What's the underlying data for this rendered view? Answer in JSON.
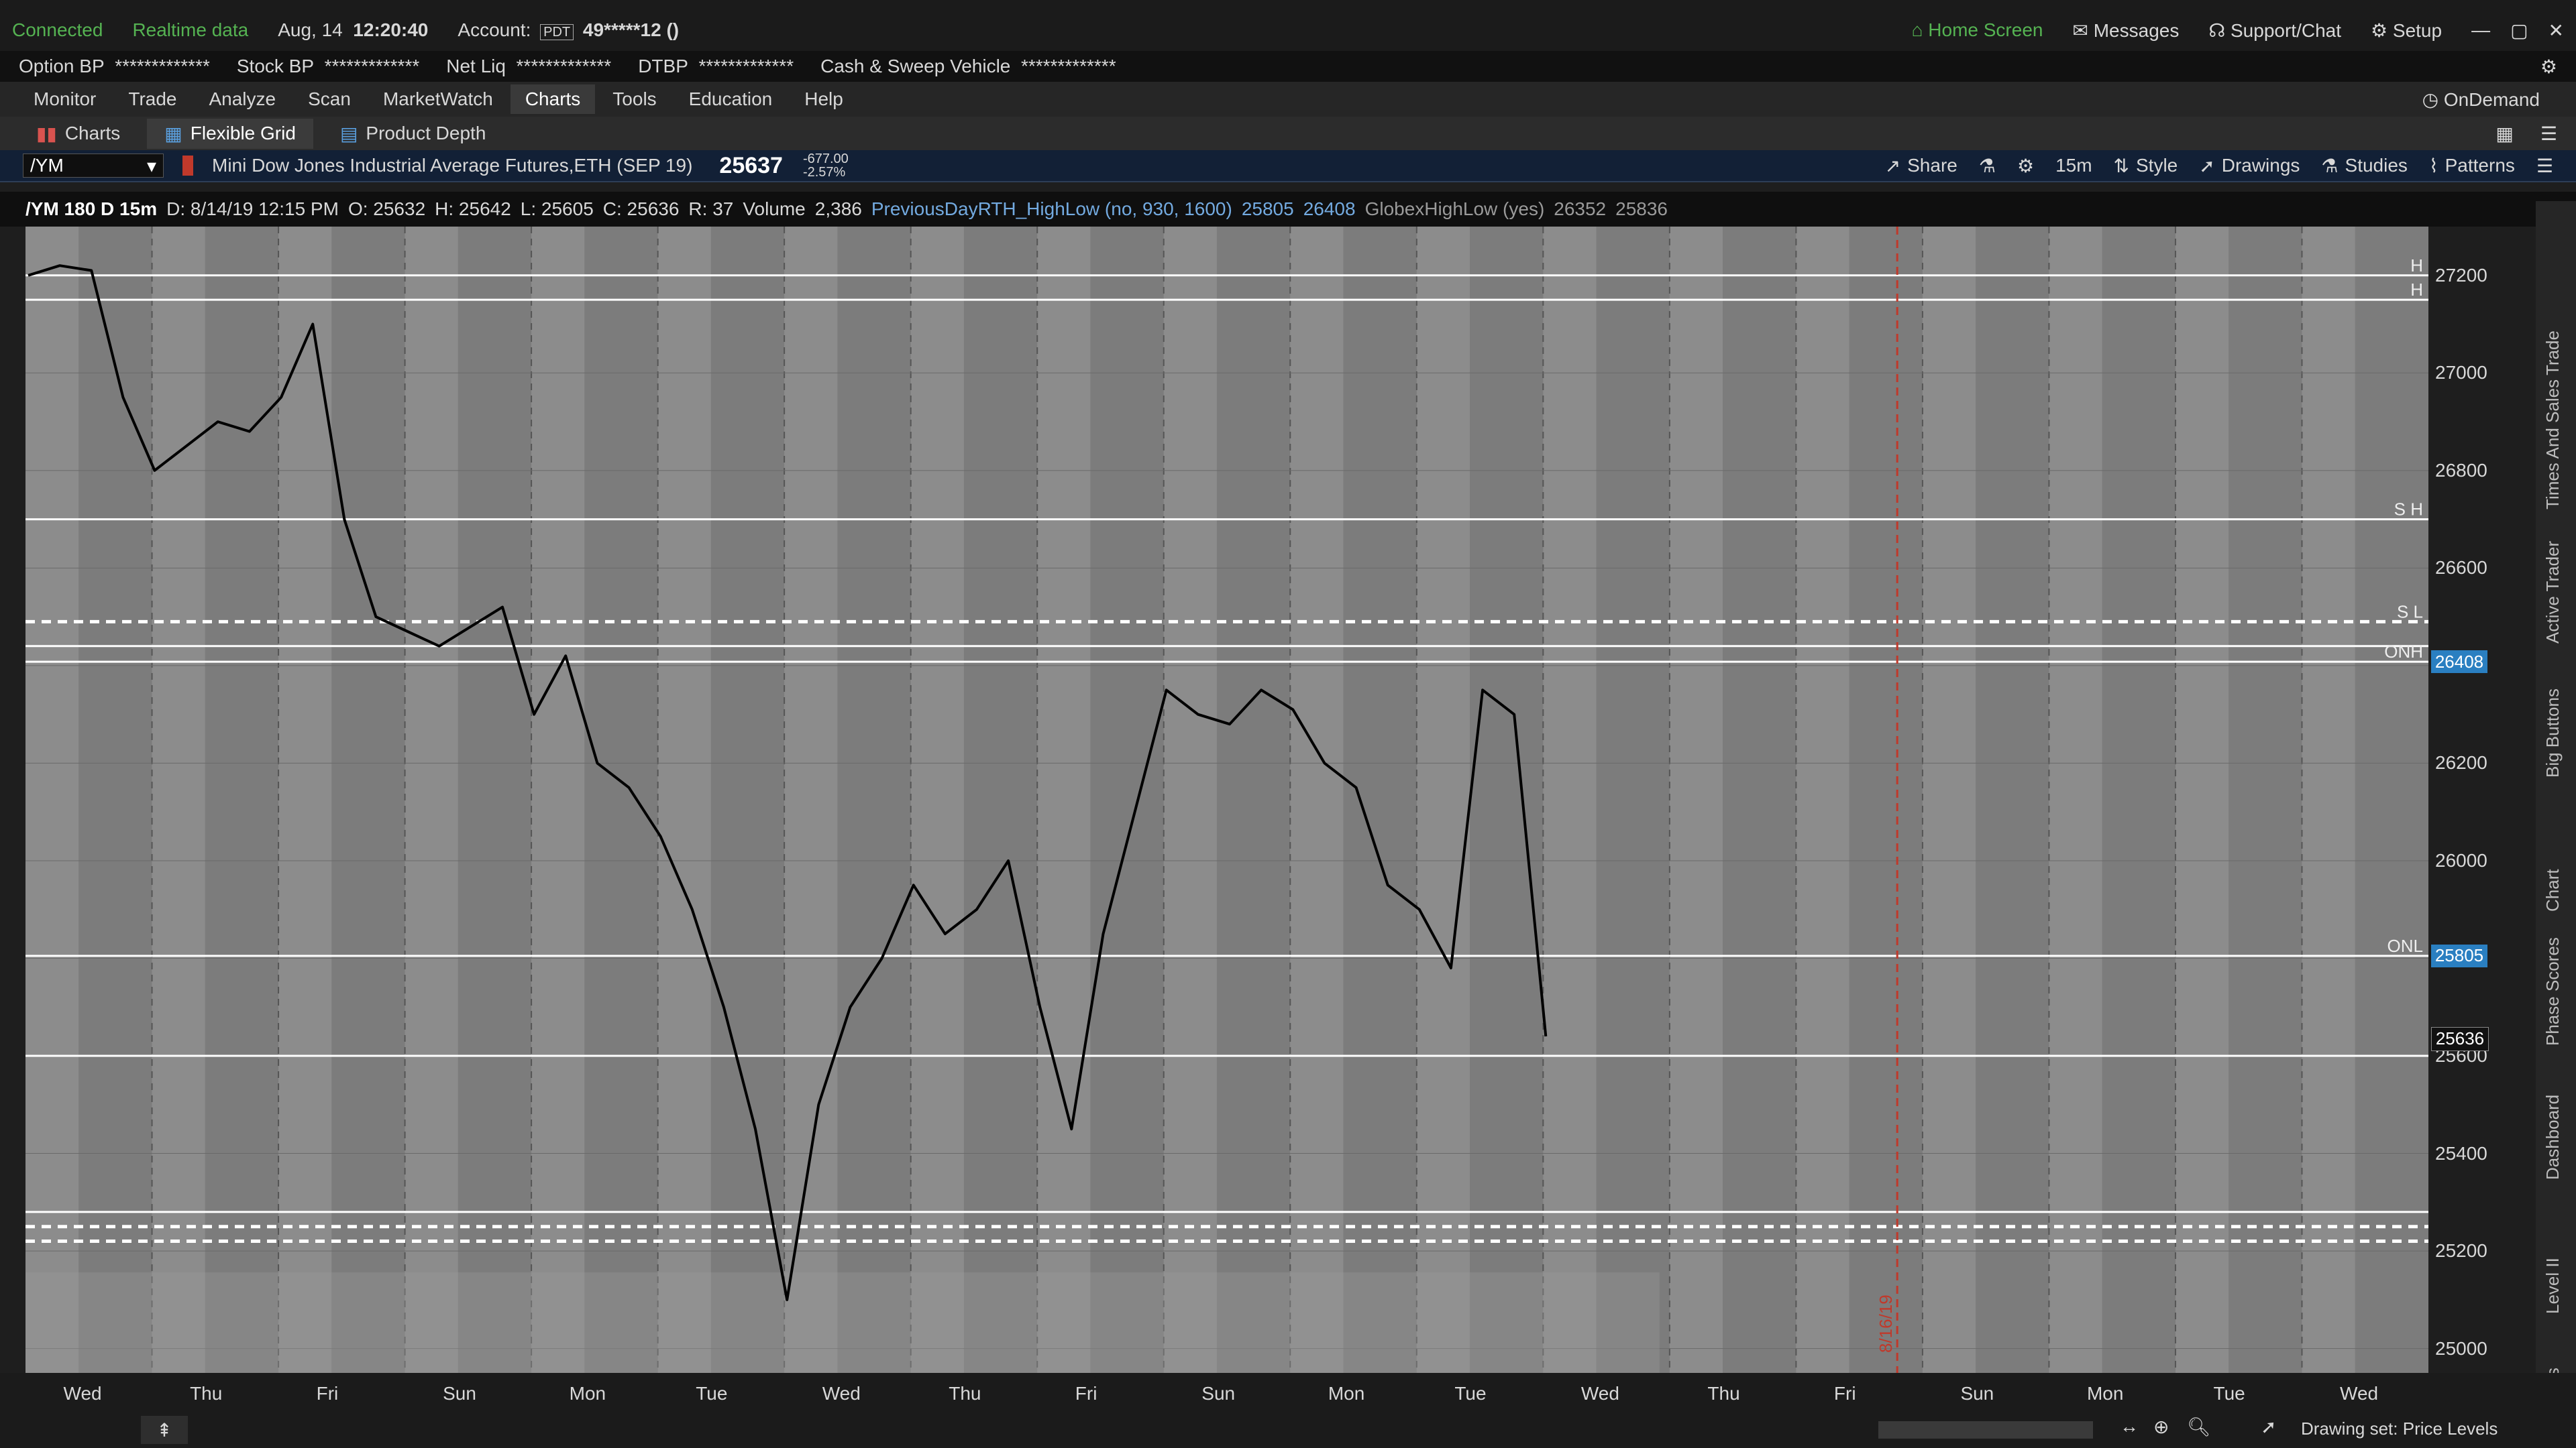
{
  "status": {
    "connected": "Connected",
    "realtime": "Realtime data",
    "date": "Aug, 14",
    "time": "12:20:40",
    "account_label": "Account:",
    "account_tag": "PDT",
    "account_value": "49*****12 ()",
    "home": "Home Screen",
    "messages": "Messages",
    "support": "Support/Chat",
    "setup": "Setup"
  },
  "bp": {
    "items": [
      {
        "label": "Option BP",
        "value": "*************"
      },
      {
        "label": "Stock BP",
        "value": "*************"
      },
      {
        "label": "Net Liq",
        "value": "*************"
      },
      {
        "label": "DTBP",
        "value": "*************"
      },
      {
        "label": "Cash & Sweep Vehicle",
        "value": "*************"
      }
    ]
  },
  "menu": {
    "items": [
      "Monitor",
      "Trade",
      "Analyze",
      "Scan",
      "MarketWatch",
      "Charts",
      "Tools",
      "Education",
      "Help"
    ],
    "ondemand": "OnDemand"
  },
  "tabs": {
    "charts": "Charts",
    "flexible_grid": "Flexible Grid",
    "product_depth": "Product Depth"
  },
  "toolbar": {
    "symbol": "/YM",
    "description": "Mini Dow Jones Industrial Average Futures,ETH (SEP 19)",
    "last": "25637",
    "change": "-677.00",
    "change_pct": "-2.57%",
    "share": "Share",
    "timeframe": "15m",
    "style": "Style",
    "drawings": "Drawings",
    "studies": "Studies",
    "patterns": "Patterns"
  },
  "info": {
    "sym": "/YM 180 D 15m",
    "date": "D: 8/14/19 12:15 PM",
    "open": "O: 25632",
    "high": "H: 25642",
    "low": "L: 25605",
    "close": "C: 25636",
    "range": "R: 37",
    "volume_label": "Volume",
    "volume": "2,386",
    "study1": "PreviousDayRTH_HighLow (no, 930, 1600)",
    "study1_v1": "25805",
    "study1_v2": "26408",
    "study2": "GlobexHighLow (yes)",
    "study2_v1": "26352",
    "study2_v2": "25836"
  },
  "chart_data": {
    "type": "line",
    "symbol": "/YM",
    "timeframe": "15m",
    "ylim": [
      24950,
      27300
    ],
    "y_ticks": [
      25000,
      25200,
      25400,
      25600,
      25800,
      26000,
      26200,
      26400,
      26600,
      26800,
      27000,
      27200
    ],
    "y_tick_labels": [
      "25000",
      "25200",
      "25400",
      "25600",
      "25800",
      "26000",
      "26200",
      "26400",
      "26600",
      "26800",
      "27000",
      "27200"
    ],
    "x_labels": [
      "Wed",
      "Thu",
      "Fri",
      "Sun",
      "Mon",
      "Tue",
      "Wed",
      "Thu",
      "Fri",
      "Sun",
      "Mon",
      "Tue",
      "Wed",
      "Thu",
      "Fri",
      "Sun",
      "Mon",
      "Tue",
      "Wed"
    ],
    "series": [
      {
        "x_session": [
          0,
          0.5,
          1,
          1.5,
          2,
          2.5,
          3,
          3.5,
          4,
          4.5,
          5,
          5.5,
          6,
          6.5,
          7,
          7.5,
          8,
          8.5,
          9,
          9.5,
          10,
          10.5,
          11,
          11.5,
          12,
          12.5,
          13,
          13.5,
          14,
          14.5,
          15,
          15.5,
          16,
          16.5,
          17,
          17.5,
          18,
          18.5,
          19,
          19.5,
          20,
          20.5,
          21,
          21.5,
          22,
          22.5,
          23,
          23.5,
          24
        ],
        "values": [
          27200,
          27220,
          27210,
          26950,
          26800,
          26850,
          26900,
          26880,
          26950,
          27100,
          26700,
          26500,
          26470,
          26440,
          26480,
          26520,
          26300,
          26420,
          26200,
          26150,
          26050,
          25900,
          25700,
          25450,
          25100,
          25500,
          25700,
          25800,
          25950,
          25850,
          25900,
          26000,
          25700,
          25450,
          25850,
          26100,
          26350,
          26300,
          26280,
          26350,
          26310,
          26200,
          26150,
          25950,
          25900,
          25780,
          26350,
          26300,
          25640
        ]
      }
    ],
    "levels": [
      {
        "price": 27200,
        "style": "solid",
        "label": "H"
      },
      {
        "price": 27150,
        "style": "solid",
        "label": "H"
      },
      {
        "price": 26700,
        "style": "solid",
        "label": "S H"
      },
      {
        "price": 26490,
        "style": "dashed",
        "label": "S L"
      },
      {
        "price": 26440,
        "style": "solid",
        "label": ""
      },
      {
        "price": 26408,
        "style": "solid",
        "label": "ONH"
      },
      {
        "price": 25805,
        "style": "solid",
        "label": "ONL"
      },
      {
        "price": 25600,
        "style": "solid",
        "label": ""
      },
      {
        "price": 25280,
        "style": "solid",
        "label": ""
      },
      {
        "price": 25250,
        "style": "dashed",
        "label": ""
      },
      {
        "price": 25220,
        "style": "dashed",
        "label": ""
      }
    ],
    "price_flags": [
      {
        "price": 26408,
        "label": "26408"
      },
      {
        "price": 25805,
        "label": "25805"
      },
      {
        "price": 25636,
        "label": "25636"
      }
    ],
    "event_marker": "8/16/19"
  },
  "bottom": {
    "drawing_set": "Drawing set: Price Levels"
  },
  "side_tabs": [
    "Trade",
    "Times And Sales",
    "Active Trader",
    "Big Buttons",
    "Chart",
    "Phase Scores",
    "Dashboard",
    "Level II",
    "Live News"
  ]
}
